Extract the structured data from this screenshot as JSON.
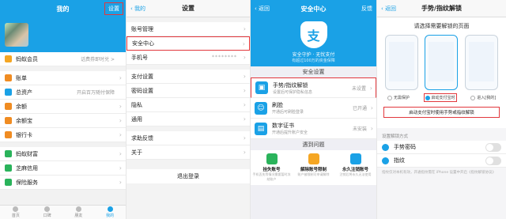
{
  "panel1": {
    "title": "我的",
    "settings_label": "设置",
    "profile_name_masked": "",
    "items": [
      {
        "label": "蚂蚁会员",
        "sub": "话费券即时兑 >",
        "color": "#f5a623"
      },
      {
        "label": "账单",
        "sub": "",
        "color": "#f08c22"
      },
      {
        "label": "总资产",
        "sub": "开启百万随付保障",
        "color": "#1aa1e6"
      },
      {
        "label": "余额",
        "sub": "",
        "color": "#f08c22"
      },
      {
        "label": "余额宝",
        "sub": "",
        "color": "#f08c22"
      },
      {
        "label": "银行卡",
        "sub": "",
        "color": "#f08c22"
      },
      {
        "label": "蚂蚁财富",
        "sub": "",
        "color": "#2ab35b"
      },
      {
        "label": "芝麻信用",
        "sub": "",
        "color": "#2ab35b"
      },
      {
        "label": "保险服务",
        "sub": "",
        "color": "#2ab35b"
      }
    ],
    "tabs": [
      "首页",
      "口碑",
      "朋友",
      "我的"
    ]
  },
  "panel2": {
    "back": "我的",
    "title": "设置",
    "items": [
      "账号管理",
      "安全中心",
      "手机号",
      "支付设置",
      "密码设置",
      "隐私",
      "通用",
      "求助反馈",
      "关于"
    ],
    "phone_masked": "********",
    "logout": "退出登录"
  },
  "panel3": {
    "back": "返回",
    "title": "安全中心",
    "right": "反馈",
    "hero_icon": "支",
    "hero_line1": "安全守护 · 无忧支付",
    "hero_line2": "有超过100万的资金保障",
    "section_security": "安全设置",
    "security_items": [
      {
        "label": "手势/指纹解锁",
        "desc": "设置后可保护隐私信息",
        "state": "未设置",
        "color": "#1aa1e6",
        "icon": "▣"
      },
      {
        "label": "刷脸",
        "desc": "开通后可刷脸登录",
        "state": "已开通",
        "color": "#1aa1e6",
        "icon": "☺"
      },
      {
        "label": "数字证书",
        "desc": "开通后提升账户安全",
        "state": "未安装",
        "color": "#1aa1e6",
        "icon": "▤"
      }
    ],
    "section_issues": "遇到问题",
    "issues": [
      {
        "label": "挂失账号",
        "desc": "手机丢失等情况需要暂时冻结账户",
        "color": "#2ab35b"
      },
      {
        "label": "解除账号限制",
        "desc": "账户被限制可申请解除",
        "color": "#f5a623"
      },
      {
        "label": "永久注销账号",
        "desc": "注销后将永久无法使用",
        "color": "#1aa1e6"
      }
    ]
  },
  "panel4": {
    "back": "返回",
    "title": "手势/指纹解锁",
    "prompt": "请选择需要解锁的页面",
    "options": [
      "无需保护",
      "启动支付宝时",
      "进入[我的]"
    ],
    "selected_index": 1,
    "note": "启动支付宝时使用手势或指纹解锁",
    "caption": "设置解锁方式",
    "toggles": [
      "手势密码",
      "指纹"
    ],
    "footnote": "指纹仅对本机有效，开通指纹需在 iPhone 设置中开启《指纹解锁协议》"
  }
}
